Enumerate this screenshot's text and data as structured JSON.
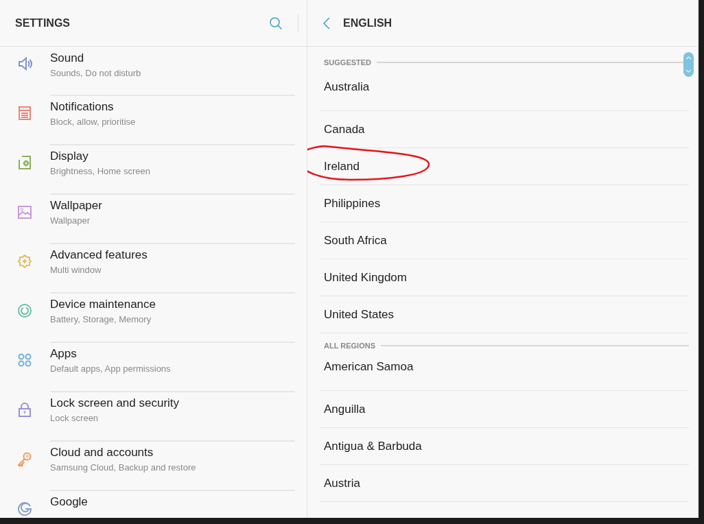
{
  "settings": {
    "title": "SETTINGS",
    "items": [
      {
        "kind": "sound",
        "color": "#7b93d6",
        "title": "Sound",
        "subtitle": "Sounds, Do not disturb"
      },
      {
        "kind": "notifications",
        "color": "#e8857a",
        "title": "Notifications",
        "subtitle": "Block, allow, prioritise"
      },
      {
        "kind": "display",
        "color": "#8bb05a",
        "title": "Display",
        "subtitle": "Brightness, Home screen"
      },
      {
        "kind": "wallpaper",
        "color": "#c79ad6",
        "title": "Wallpaper",
        "subtitle": "Wallpaper"
      },
      {
        "kind": "advanced",
        "color": "#e9bd5c",
        "title": "Advanced features",
        "subtitle": "Multi window"
      },
      {
        "kind": "maintenance",
        "color": "#6cc1a8",
        "title": "Device maintenance",
        "subtitle": "Battery, Storage, Memory"
      },
      {
        "kind": "apps",
        "color": "#6fb3dc",
        "title": "Apps",
        "subtitle": "Default apps, App permissions"
      },
      {
        "kind": "lock",
        "color": "#9a8fdc",
        "title": "Lock screen and security",
        "subtitle": "Lock screen"
      },
      {
        "kind": "cloud",
        "color": "#ee9a5e",
        "title": "Cloud and accounts",
        "subtitle": "Samsung Cloud, Backup and restore"
      },
      {
        "kind": "google",
        "color": "#8aa0c8",
        "title": "Google"
      }
    ]
  },
  "english": {
    "title": "ENGLISH",
    "sections": [
      {
        "header": "SUGGESTED",
        "items": [
          {
            "label": "Australia",
            "circled": false
          },
          {
            "label": "Canada",
            "circled": false
          },
          {
            "label": "Ireland",
            "circled": true
          },
          {
            "label": "Philippines",
            "circled": false
          },
          {
            "label": "South Africa",
            "circled": false
          },
          {
            "label": "United Kingdom",
            "circled": false
          },
          {
            "label": "United States",
            "circled": false
          }
        ]
      },
      {
        "header": "ALL REGIONS",
        "items": [
          {
            "label": "American Samoa",
            "circled": false
          },
          {
            "label": "Anguilla",
            "circled": false
          },
          {
            "label": "Antigua & Barbuda",
            "circled": false
          },
          {
            "label": "Austria",
            "circled": false
          }
        ]
      }
    ]
  }
}
